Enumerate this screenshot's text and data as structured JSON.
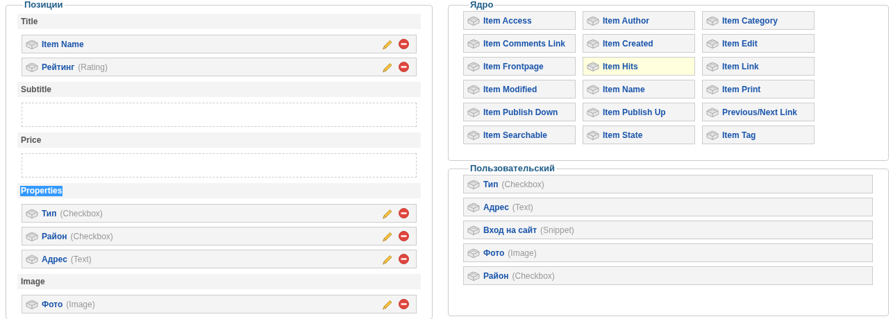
{
  "positions": {
    "title": "Позиции",
    "groups": [
      {
        "label": "Title",
        "highlighted": false,
        "items": [
          {
            "name": "Item Name"
          },
          {
            "name": "Рейтинг",
            "type": "(Rating)"
          }
        ]
      },
      {
        "label": "Subtitle",
        "highlighted": false
      },
      {
        "label": "Price",
        "highlighted": false
      },
      {
        "label": "Properties",
        "highlighted": true,
        "items": [
          {
            "name": "Тип",
            "type": "(Checkbox)"
          },
          {
            "name": "Район",
            "type": "(Checkbox)"
          },
          {
            "name": "Адрес",
            "type": "(Text)"
          }
        ]
      },
      {
        "label": "Image",
        "highlighted": false,
        "items": [
          {
            "name": "Фото",
            "type": "(Image)"
          }
        ]
      }
    ]
  },
  "core": {
    "title": "Ядро",
    "items": [
      {
        "name": "Item Access",
        "highlighted": false
      },
      {
        "name": "Item Author",
        "highlighted": false
      },
      {
        "name": "Item Category",
        "highlighted": false
      },
      {
        "name": "Item Comments Link",
        "highlighted": false
      },
      {
        "name": "Item Created",
        "highlighted": false
      },
      {
        "name": "Item Edit",
        "highlighted": false
      },
      {
        "name": "Item Frontpage",
        "highlighted": false
      },
      {
        "name": "Item Hits",
        "highlighted": true
      },
      {
        "name": "Item Link",
        "highlighted": false
      },
      {
        "name": "Item Modified",
        "highlighted": false
      },
      {
        "name": "Item Name",
        "highlighted": false
      },
      {
        "name": "Item Print",
        "highlighted": false
      },
      {
        "name": "Item Publish Down",
        "highlighted": false
      },
      {
        "name": "Item Publish Up",
        "highlighted": false
      },
      {
        "name": "Previous/Next Link",
        "highlighted": false
      },
      {
        "name": "Item Searchable",
        "highlighted": false
      },
      {
        "name": "Item State",
        "highlighted": false
      },
      {
        "name": "Item Tag",
        "highlighted": false
      }
    ]
  },
  "custom": {
    "title": "Пользовательский",
    "items": [
      {
        "name": "Тип",
        "type": "(Checkbox)"
      },
      {
        "name": "Адрес",
        "type": "(Text)"
      },
      {
        "name": "Вход на сайт",
        "type": "(Snippet)"
      },
      {
        "name": "Фото",
        "type": "(Image)"
      },
      {
        "name": "Район",
        "type": "(Checkbox)"
      }
    ]
  }
}
